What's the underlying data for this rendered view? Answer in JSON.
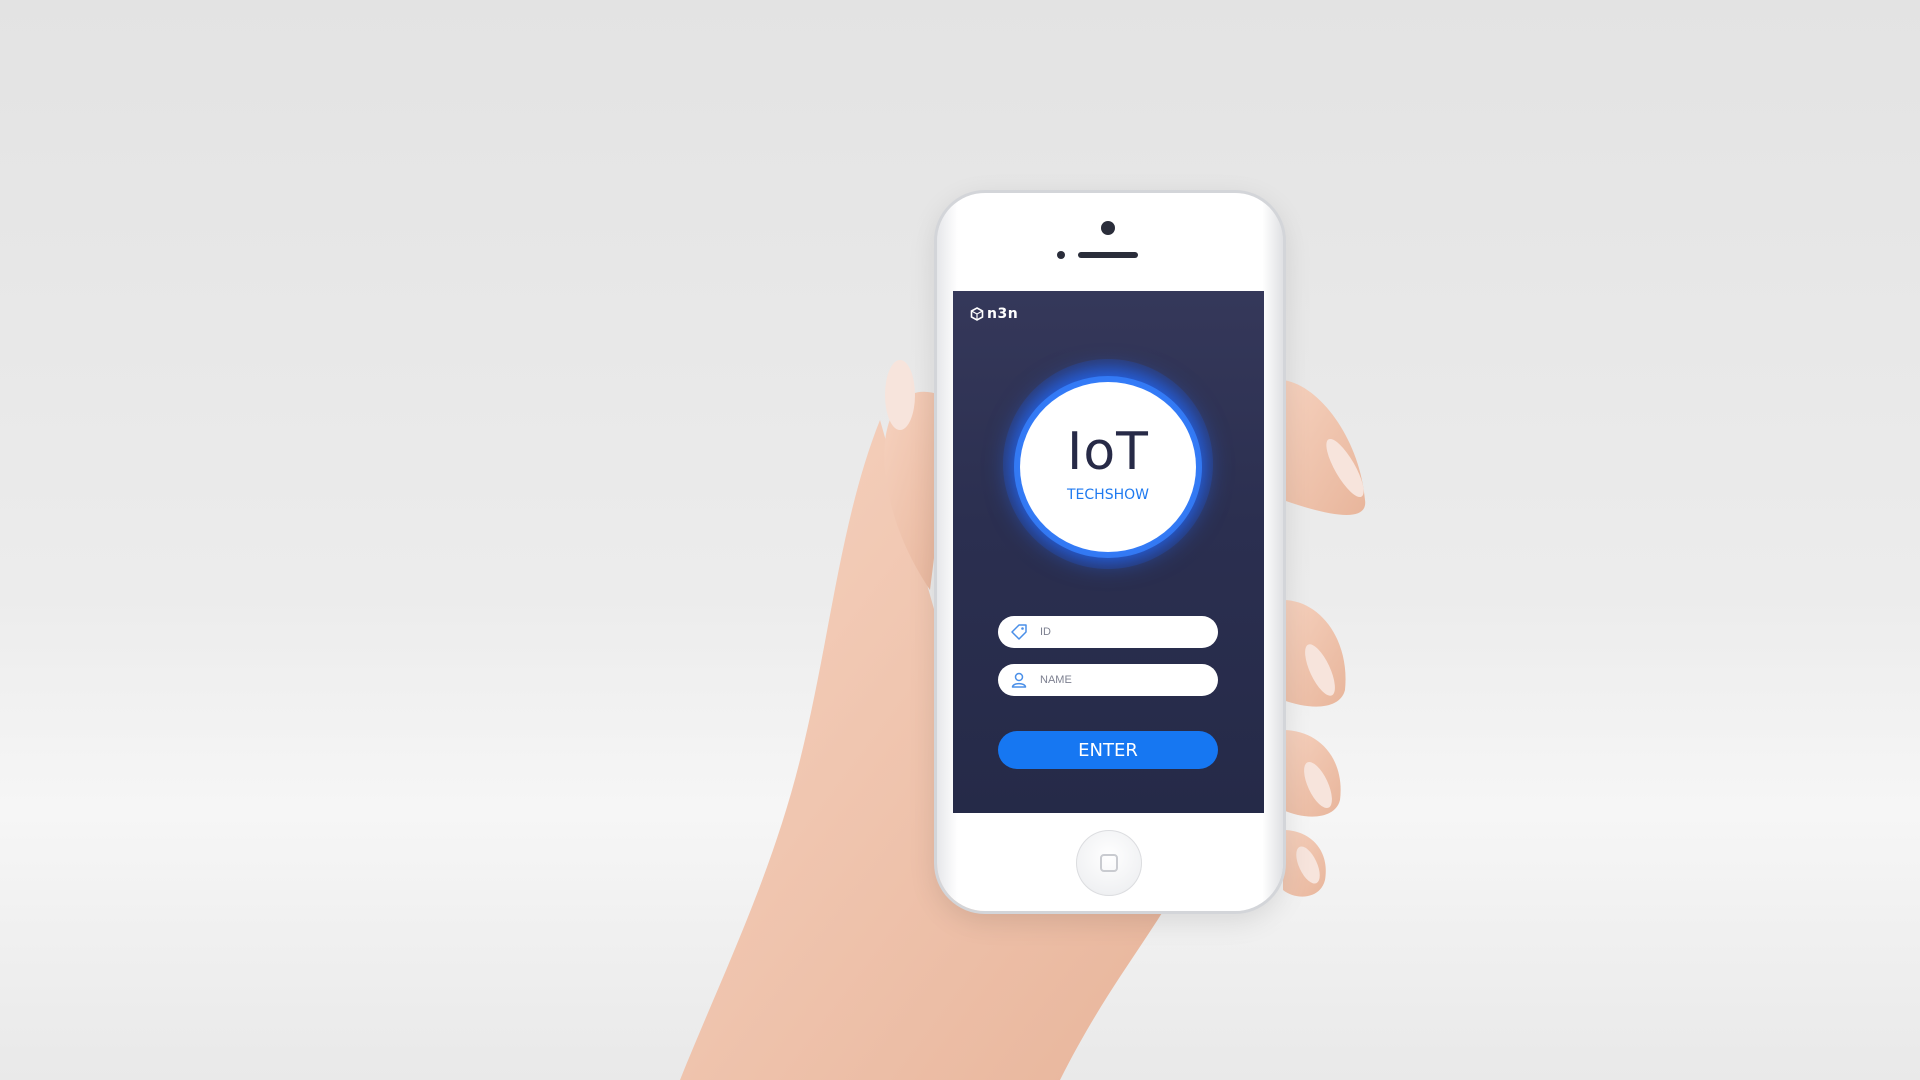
{
  "app": {
    "brand": "n3n",
    "logo_title": "IoT",
    "logo_subtitle": "TECHSHOW"
  },
  "form": {
    "id_field": {
      "placeholder": "ID",
      "icon": "tag-icon"
    },
    "name_field": {
      "placeholder": "NAME",
      "icon": "user-icon"
    },
    "enter_label": "ENTER"
  },
  "colors": {
    "screen_bg": "#2b2f50",
    "accent": "#1677f2",
    "logo_text": "#272a47"
  }
}
